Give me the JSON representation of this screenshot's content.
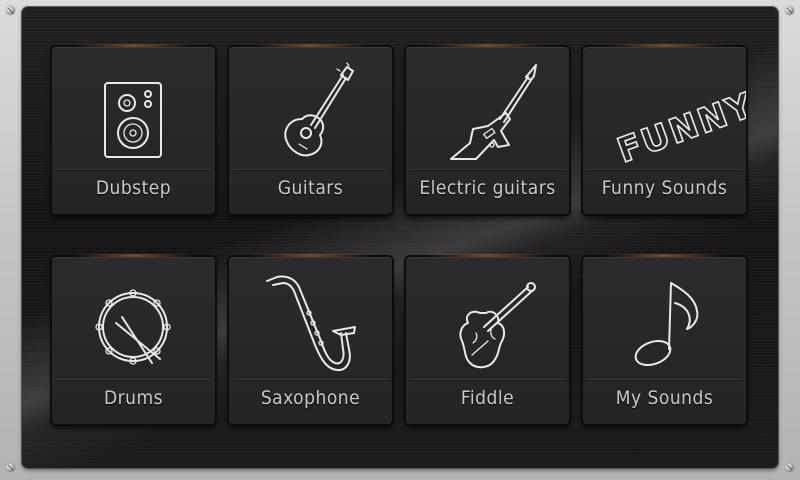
{
  "tiles": [
    {
      "label": "Dubstep",
      "icon": "speaker-icon"
    },
    {
      "label": "Guitars",
      "icon": "acoustic-guitar-icon"
    },
    {
      "label": "Electric guitars",
      "icon": "electric-guitar-icon"
    },
    {
      "label": "Funny Sounds",
      "icon": "funny-text-icon",
      "icon_text": "FUNNY"
    },
    {
      "label": "Drums",
      "icon": "drum-icon"
    },
    {
      "label": "Saxophone",
      "icon": "saxophone-icon"
    },
    {
      "label": "Fiddle",
      "icon": "violin-icon"
    },
    {
      "label": "My Sounds",
      "icon": "music-note-icon"
    }
  ]
}
